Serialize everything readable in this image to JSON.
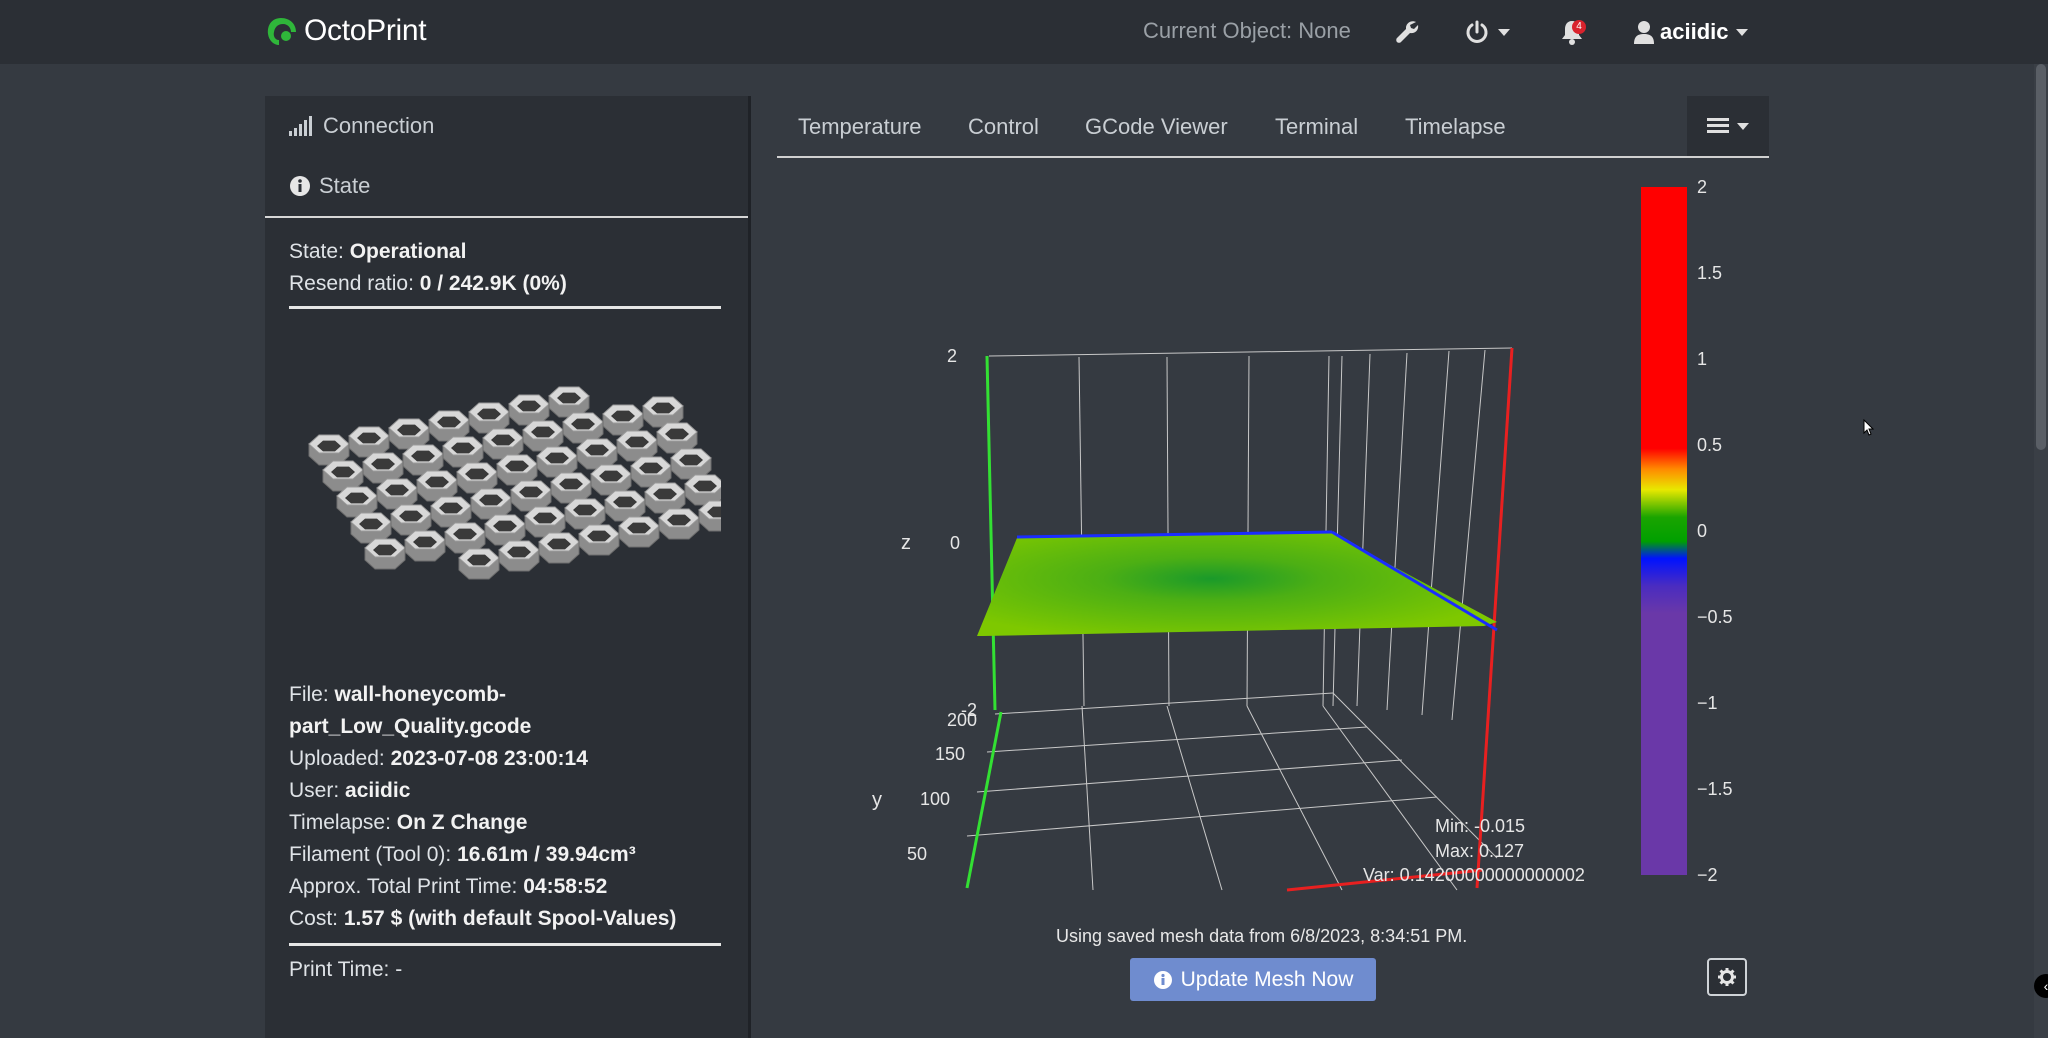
{
  "app": {
    "brand": "OctoPrint",
    "current_object": "Current Object: None",
    "user": "aciidic",
    "notification_count": "4",
    "colors": {
      "accent_green": "#2fb63a",
      "button_blue": "#6f8ccf",
      "badge_red": "#d9232d"
    }
  },
  "sidebar": {
    "connection_label": "Connection",
    "state_label": "State",
    "state": {
      "label": "State:",
      "value": "Operational"
    },
    "resend": {
      "label": "Resend ratio:",
      "value": "0 / 242.9K (0%)"
    },
    "file": {
      "label": "File:",
      "value_line1": "wall-honeycomb-",
      "value_line2": "part_Low_Quality.gcode"
    },
    "uploaded": {
      "label": "Uploaded:",
      "value": "2023-07-08 23:00:14"
    },
    "user": {
      "label": "User:",
      "value": "aciidic"
    },
    "timelapse": {
      "label": "Timelapse:",
      "value": "On Z Change"
    },
    "filament": {
      "label": "Filament (Tool 0):",
      "value": "16.61m / 39.94cm³"
    },
    "print_time_est": {
      "label": "Approx. Total Print Time:",
      "value": "04:58:52"
    },
    "cost": {
      "label": "Cost:",
      "value": "1.57 $ (with default Spool-Values)"
    },
    "print_time": {
      "label": "Print Time:",
      "value": "-"
    }
  },
  "tabs": [
    {
      "label": "Temperature"
    },
    {
      "label": "Control"
    },
    {
      "label": "GCode Viewer"
    },
    {
      "label": "Terminal"
    },
    {
      "label": "Timelapse"
    }
  ],
  "chart_data": {
    "type": "surface",
    "axes": {
      "z_label": "z",
      "y_label": "y",
      "z_ticks": [
        "2",
        "0",
        "-2"
      ],
      "y_ticks": [
        "200",
        "150",
        "100",
        "50"
      ]
    },
    "colorbar": {
      "ticks": [
        "2",
        "1.5",
        "1",
        "0.5",
        "0",
        "−0.5",
        "−1",
        "−1.5",
        "−2"
      ],
      "range": [
        -2,
        2
      ]
    },
    "stats": {
      "min": "Min: -0.015",
      "max": "Max: 0.127",
      "var": "Var: 0.14200000000000002"
    },
    "mesh_range": {
      "min": -0.015,
      "max": 0.127
    }
  },
  "mesh": {
    "footer": "Using saved mesh data from 6/8/2023, 8:34:51 PM.",
    "update_button": "Update Mesh Now"
  }
}
